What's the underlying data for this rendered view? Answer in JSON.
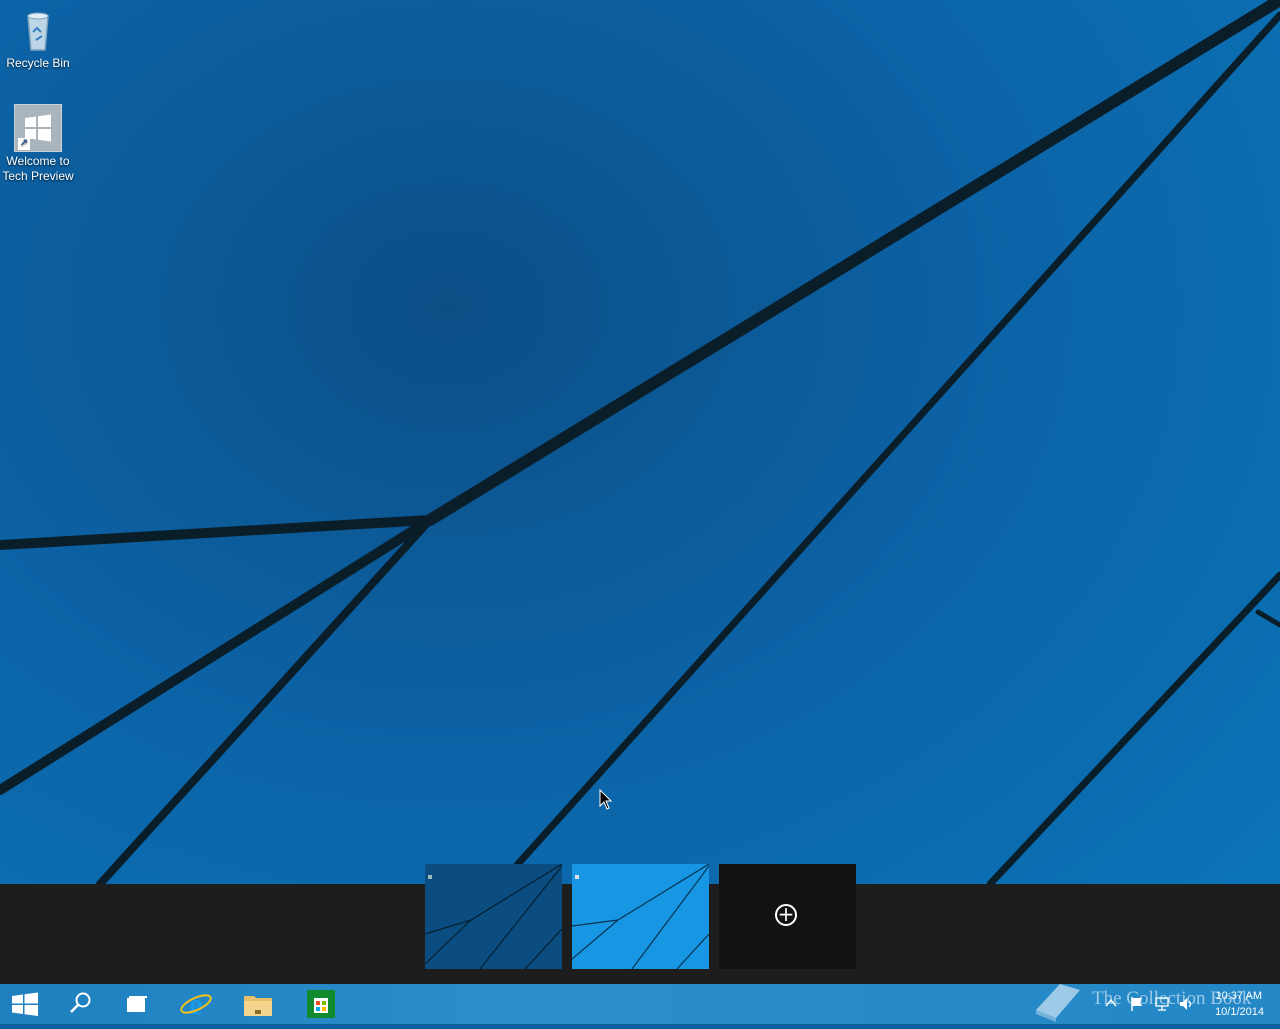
{
  "desktop": {
    "icons": [
      {
        "label": "Recycle Bin",
        "icon": "recycle-bin-icon"
      },
      {
        "label": "Welcome to\nTech Preview",
        "label_line1": "Welcome to",
        "label_line2": "Tech Preview",
        "icon": "windows-logo-icon"
      }
    ]
  },
  "task_view": {
    "desktops": [
      {
        "name": "desktop-1",
        "icon": "desktop-thumbnail"
      },
      {
        "name": "desktop-2",
        "icon": "desktop-thumbnail"
      }
    ],
    "add_desktop_icon": "plus-circle-icon"
  },
  "taskbar": {
    "buttons": [
      {
        "name": "start",
        "icon": "windows-logo-icon"
      },
      {
        "name": "search",
        "icon": "search-icon"
      },
      {
        "name": "task-view",
        "icon": "task-view-icon"
      },
      {
        "name": "internet-explorer",
        "icon": "internet-explorer-icon"
      },
      {
        "name": "file-explorer",
        "icon": "folder-icon"
      },
      {
        "name": "store",
        "icon": "store-icon"
      }
    ],
    "tray": {
      "time": "10:37 AM",
      "date": "10/1/2014",
      "icons": [
        "chevron-up-icon",
        "flag-icon",
        "network-icon",
        "volume-icon"
      ]
    }
  },
  "watermark": {
    "text": "The Collection Book"
  },
  "colors": {
    "wallpaper": "#0a5f9c",
    "taskbar": "#2487c6",
    "task_view_bar": "#1d1d1d",
    "accent": "#1696e3"
  }
}
